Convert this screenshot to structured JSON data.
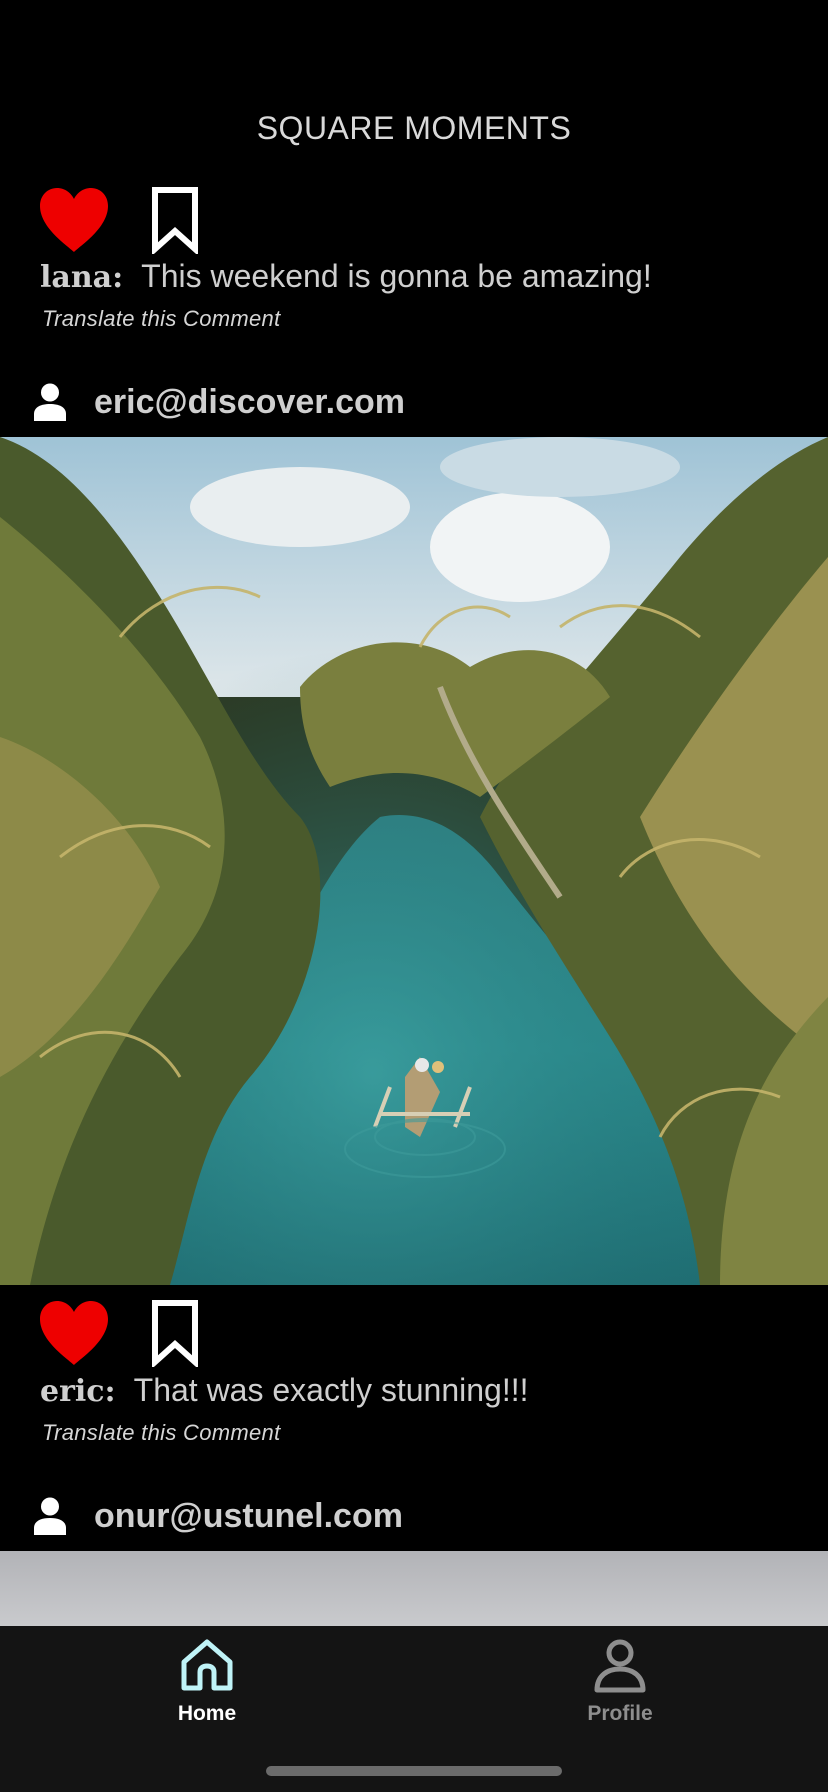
{
  "app": {
    "title": "SQUARE MOMENTS"
  },
  "feed": [
    {
      "liked": true,
      "bookmarked": false,
      "comment_user": "lana:",
      "comment_text": "This weekend is gonna be amazing!",
      "translate_label": "Translate this Comment"
    },
    {
      "author_email": "eric@discover.com",
      "image": "tropical river with palm trees and a small boat",
      "liked": true,
      "bookmarked": false,
      "comment_user": "eric:",
      "comment_text": "That was exactly stunning!!!",
      "translate_label": "Translate this Comment"
    },
    {
      "author_email": "onur@ustunel.com",
      "image": "grey sky photo (partially visible)"
    }
  ],
  "icons": {
    "like": "heart-icon",
    "bookmark": "bookmark-icon",
    "author": "person-icon",
    "home": "home-icon",
    "profile": "profile-icon"
  },
  "nav": {
    "home_label": "Home",
    "profile_label": "Profile",
    "active": "Home"
  },
  "colors": {
    "background": "#000000",
    "like_active": "#ee0000",
    "nav_active": "#bff3f7",
    "nav_inactive": "#8e8e8e",
    "nav_background": "#141414"
  }
}
